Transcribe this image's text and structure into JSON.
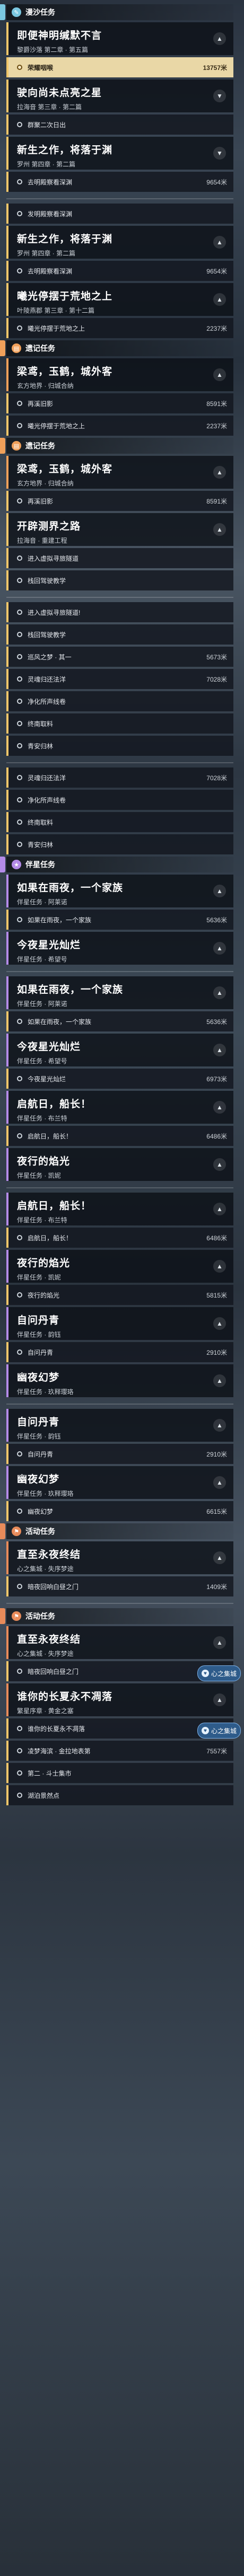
{
  "tracks": [
    {
      "kind": "header",
      "label": "漫沙任务",
      "color": "#7bc7e0",
      "icon": "feather-icon"
    },
    {
      "kind": "quest",
      "title": "即便神明缄默不言",
      "sub": "黎爵沙落 第二章 · 第五篇",
      "expanded": true,
      "accent": "#f0c66a"
    },
    {
      "kind": "step",
      "label": "荣耀咽喉",
      "dist": "13757米",
      "active": true
    },
    {
      "kind": "quest",
      "title": "驶向尚未点亮之星",
      "sub": "拉海音 第三章 · 第二篇",
      "expanded": false,
      "accent": "#f0c66a"
    },
    {
      "kind": "step",
      "label": "群聚二次日出",
      "dist": "",
      "active": false
    },
    {
      "kind": "quest",
      "title": "新生之作，将落于渊",
      "sub": "罗州 第四章 · 第二篇",
      "expanded": false,
      "accent": "#f0c66a"
    },
    {
      "kind": "step",
      "label": "去明殿察看深渊",
      "dist": "9654米",
      "active": false
    },
    {
      "kind": "sep"
    },
    {
      "kind": "step",
      "label": "发明殿察看深渊",
      "dist": "",
      "active": false
    },
    {
      "kind": "quest",
      "title": "新生之作，将落于渊",
      "sub": "罗州 第四章 · 第二篇",
      "expanded": true,
      "accent": "#f0c66a"
    },
    {
      "kind": "step",
      "label": "去明殿察看深渊",
      "dist": "9654米",
      "active": false
    },
    {
      "kind": "quest",
      "title": "曦光停摆于荒地之上",
      "sub": "叶陵燕郡 第三章 · 第十二篇",
      "expanded": true,
      "accent": "#f0c66a"
    },
    {
      "kind": "step",
      "label": "曦光停摆于荒地之上",
      "dist": "2237米",
      "active": false
    },
    {
      "kind": "header",
      "label": "遗记任务",
      "color": "#f0a05a",
      "icon": "book-icon"
    },
    {
      "kind": "quest",
      "title": "梁鸢，玉鹤，城外客",
      "sub": "玄方地界 · 归城合纳",
      "expanded": true,
      "accent": "#f0a05a"
    },
    {
      "kind": "step",
      "label": "再溪旧影",
      "dist": "8591米",
      "active": false
    },
    {
      "kind": "step",
      "label": "曦光停摆于荒地之上",
      "dist": "2237米",
      "active": false
    },
    {
      "kind": "header",
      "label": "遗记任务",
      "color": "#f0a05a",
      "icon": "book-icon"
    },
    {
      "kind": "quest",
      "title": "梁鸢，玉鹤，城外客",
      "sub": "玄方地界 · 归城合纳",
      "expanded": true,
      "accent": "#f0a05a"
    },
    {
      "kind": "step",
      "label": "再溪旧影",
      "dist": "8591米",
      "active": false
    },
    {
      "kind": "quest",
      "title": "开辟测界之路",
      "sub": "拉海音 · 重建工程",
      "expanded": true,
      "accent": "#f0c66a"
    },
    {
      "kind": "step",
      "label": "进入虚拟寻旅隧道",
      "dist": "",
      "active": false
    },
    {
      "kind": "step",
      "label": "栈回驾驶教学",
      "dist": "",
      "active": false
    },
    {
      "kind": "sep"
    },
    {
      "kind": "step",
      "label": "进入虚拟寻旅隧道!",
      "dist": "",
      "active": false
    },
    {
      "kind": "step",
      "label": "栈回驾驶教学",
      "dist": "",
      "active": false
    },
    {
      "kind": "step",
      "label": "巡风之梦 · 其一",
      "dist": "5673米",
      "active": false
    },
    {
      "kind": "step",
      "label": "灵魂归还法洋",
      "dist": "7028米",
      "active": false
    },
    {
      "kind": "step",
      "label": "净化所声线卷",
      "dist": "",
      "active": false
    },
    {
      "kind": "step",
      "label": "终南取料",
      "dist": "",
      "active": false
    },
    {
      "kind": "step",
      "label": "青安归林",
      "dist": "",
      "active": false
    },
    {
      "kind": "sep"
    },
    {
      "kind": "step",
      "label": "灵魂归还法洋",
      "dist": "7028米",
      "active": false
    },
    {
      "kind": "step",
      "label": "净化所声线卷",
      "dist": "",
      "active": false
    },
    {
      "kind": "step",
      "label": "终南取料",
      "dist": "",
      "active": false
    },
    {
      "kind": "step",
      "label": "青安归林",
      "dist": "",
      "active": false
    },
    {
      "kind": "header",
      "label": "伴星任务",
      "color": "#b48be8",
      "icon": "star-icon"
    },
    {
      "kind": "quest",
      "title": "如果在雨夜，一个家族",
      "sub": "伴星任务 · 阿莱诺",
      "expanded": true,
      "accent": "#b48be8"
    },
    {
      "kind": "step",
      "label": "如果在雨夜，一个家族",
      "dist": "5636米",
      "active": false
    },
    {
      "kind": "quest",
      "title": "今夜星光灿烂",
      "sub": "伴星任务 · 希望号",
      "expanded": true,
      "accent": "#b48be8"
    },
    {
      "kind": "sep"
    },
    {
      "kind": "quest",
      "title": "如果在雨夜，一个家族",
      "sub": "伴星任务 · 阿莱诺",
      "expanded": true,
      "accent": "#b48be8"
    },
    {
      "kind": "step",
      "label": "如果在雨夜，一个家族",
      "dist": "5636米",
      "active": false
    },
    {
      "kind": "quest",
      "title": "今夜星光灿烂",
      "sub": "伴星任务 · 希望号",
      "expanded": true,
      "accent": "#b48be8"
    },
    {
      "kind": "step",
      "label": "今夜星光灿烂",
      "dist": "6973米",
      "active": false
    },
    {
      "kind": "quest",
      "title": "启航日，船长！",
      "sub": "伴星任务 · 布兰特",
      "expanded": true,
      "accent": "#b48be8"
    },
    {
      "kind": "step",
      "label": "启航日，船长！",
      "dist": "6486米",
      "active": false
    },
    {
      "kind": "quest",
      "title": "夜行的焰光",
      "sub": "伴星任务 · 凯妮",
      "expanded": true,
      "accent": "#b48be8"
    },
    {
      "kind": "sep"
    },
    {
      "kind": "quest",
      "title": "启航日，船长！",
      "sub": "伴星任务 · 布兰特",
      "expanded": true,
      "accent": "#b48be8"
    },
    {
      "kind": "step",
      "label": "启航日，船长！",
      "dist": "6486米",
      "active": false
    },
    {
      "kind": "quest",
      "title": "夜行的焰光",
      "sub": "伴星任务 · 凯妮",
      "expanded": true,
      "accent": "#b48be8"
    },
    {
      "kind": "step",
      "label": "夜行的焰光",
      "dist": "5815米",
      "active": false
    },
    {
      "kind": "quest",
      "title": "自问丹青",
      "sub": "伴星任务 · 韵钰",
      "expanded": true,
      "accent": "#b48be8"
    },
    {
      "kind": "step",
      "label": "自问丹青",
      "dist": "2910米",
      "active": false
    },
    {
      "kind": "quest",
      "title": "幽夜幻梦",
      "sub": "伴星任务 · 玖释璎珞",
      "expanded": true,
      "accent": "#b48be8"
    },
    {
      "kind": "sep"
    },
    {
      "kind": "quest",
      "title": "自问丹青",
      "sub": "伴星任务 · 韵钰",
      "expanded": true,
      "accent": "#b48be8"
    },
    {
      "kind": "step",
      "label": "自问丹青",
      "dist": "2910米",
      "active": false
    },
    {
      "kind": "quest",
      "title": "幽夜幻梦",
      "sub": "伴星任务 · 玖释璎珞",
      "expanded": true,
      "accent": "#b48be8"
    },
    {
      "kind": "step",
      "label": "幽夜幻梦",
      "dist": "6615米",
      "active": false
    },
    {
      "kind": "header",
      "label": "活动任务",
      "color": "#e88b5a",
      "icon": "flag-icon"
    },
    {
      "kind": "quest",
      "title": "直至永夜终结",
      "sub": "心之集城 · 失序梦途",
      "expanded": true,
      "accent": "#e88b5a"
    },
    {
      "kind": "step",
      "label": "暗夜回响白昼之门",
      "dist": "1409米",
      "active": false
    },
    {
      "kind": "sep"
    },
    {
      "kind": "header",
      "label": "活动任务",
      "color": "#e88b5a",
      "icon": "flag-icon"
    },
    {
      "kind": "quest",
      "title": "直至永夜终结",
      "sub": "心之集城 · 失序梦途",
      "expanded": true,
      "accent": "#e88b5a"
    },
    {
      "kind": "step",
      "label": "暗夜回响白昼之门",
      "dist": "1409米",
      "active": false
    },
    {
      "kind": "quest",
      "title": "谁你的长夏永不凋落",
      "sub": "繁星序章 · 黄金之塞",
      "expanded": true,
      "accent": "#e88b5a"
    },
    {
      "kind": "step",
      "label": "谁你的长夏永不凋落",
      "dist": "5808米",
      "active": false
    },
    {
      "kind": "step",
      "label": "凌梦海滨 · 金拉地表第",
      "dist": "7557米",
      "active": false
    },
    {
      "kind": "step",
      "label": "第二 · 斗士集市",
      "dist": "",
      "active": false
    },
    {
      "kind": "step",
      "label": "湖泊景然点",
      "dist": "",
      "active": false
    }
  ],
  "badges": [
    {
      "label": "心之集城",
      "icon": "heart-icon",
      "anchor": "直至永夜终结"
    },
    {
      "label": "心之集城",
      "icon": "heart-icon",
      "anchor": "谁你的长夏永不凋落"
    }
  ]
}
